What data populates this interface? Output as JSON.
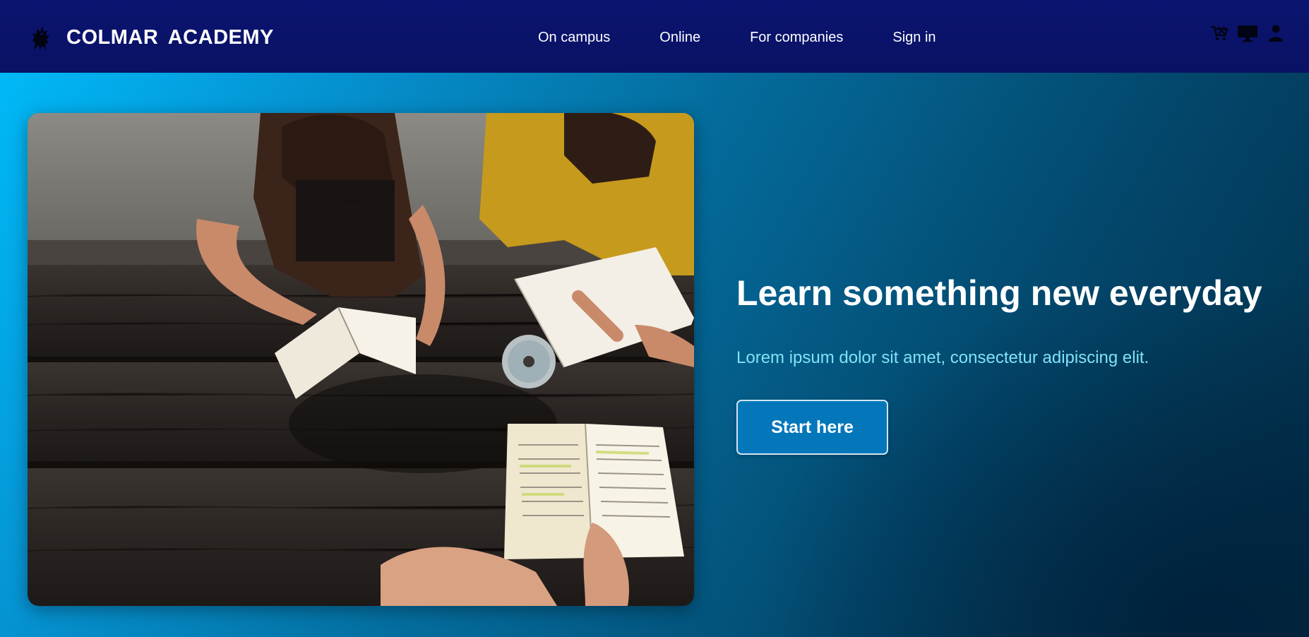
{
  "header": {
    "brand": "COLMAR  ACADEMY",
    "nav": [
      "On campus",
      "Online",
      "For companies",
      "Sign in"
    ],
    "icons": [
      "cart-icon",
      "monitor-icon",
      "user-icon"
    ]
  },
  "hero": {
    "headline": "Learn something new everyday",
    "subline": "Lorem ipsum dolor sit amet, consectetur adipiscing elit.",
    "cta_label": "Start here",
    "image_alt": "Students reading books at a wooden picnic table"
  },
  "colors": {
    "header_bg": "#0b1470",
    "hero_gradient_start": "#00b9f6",
    "hero_gradient_end": "#022c45",
    "subline": "#7fe2f5",
    "cta_bg": "#0477bb"
  }
}
